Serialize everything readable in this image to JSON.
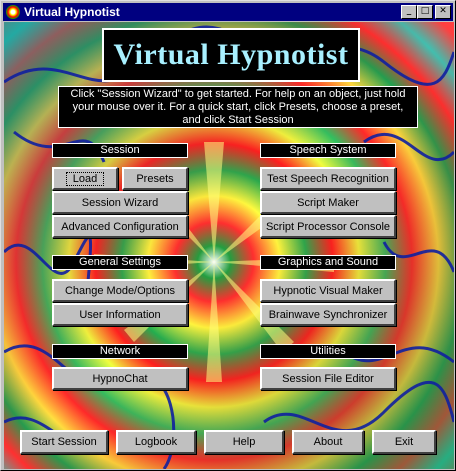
{
  "window": {
    "title": "Virtual Hypnotist",
    "minimize": "_",
    "maximize": "□",
    "close": "✕"
  },
  "banner": {
    "title": "Virtual Hypnotist"
  },
  "info": {
    "line1": "Click \"Session Wizard\" to get started. For help on an object, just hold",
    "line2": "your mouse over it.  For a quick start, click Presets, choose a preset,",
    "line3": "and click Start Session"
  },
  "sections": {
    "session": "Session",
    "speech": "Speech System",
    "general": "General Settings",
    "graphics": "Graphics and Sound",
    "network": "Network",
    "utilities": "Utilities"
  },
  "buttons": {
    "load": "Load",
    "presets": "Presets",
    "session_wizard": "Session Wizard",
    "advanced_config": "Advanced Configuration",
    "test_speech": "Test Speech Recognition",
    "script_maker": "Script Maker",
    "script_processor": "Script Processor Console",
    "change_mode": "Change Mode/Options",
    "user_info": "User Information",
    "visual_maker": "Hypnotic Visual Maker",
    "brainwave": "Brainwave Synchronizer",
    "hypnochat": "HypnoChat",
    "session_file_editor": "Session File Editor"
  },
  "footer": {
    "start_session": "Start Session",
    "logbook": "Logbook",
    "help": "Help",
    "about": "About",
    "exit": "Exit"
  },
  "colors": {
    "titlebar": "#000080",
    "banner_text": "#a8f0ff",
    "button_face": "#c0c0c0"
  }
}
